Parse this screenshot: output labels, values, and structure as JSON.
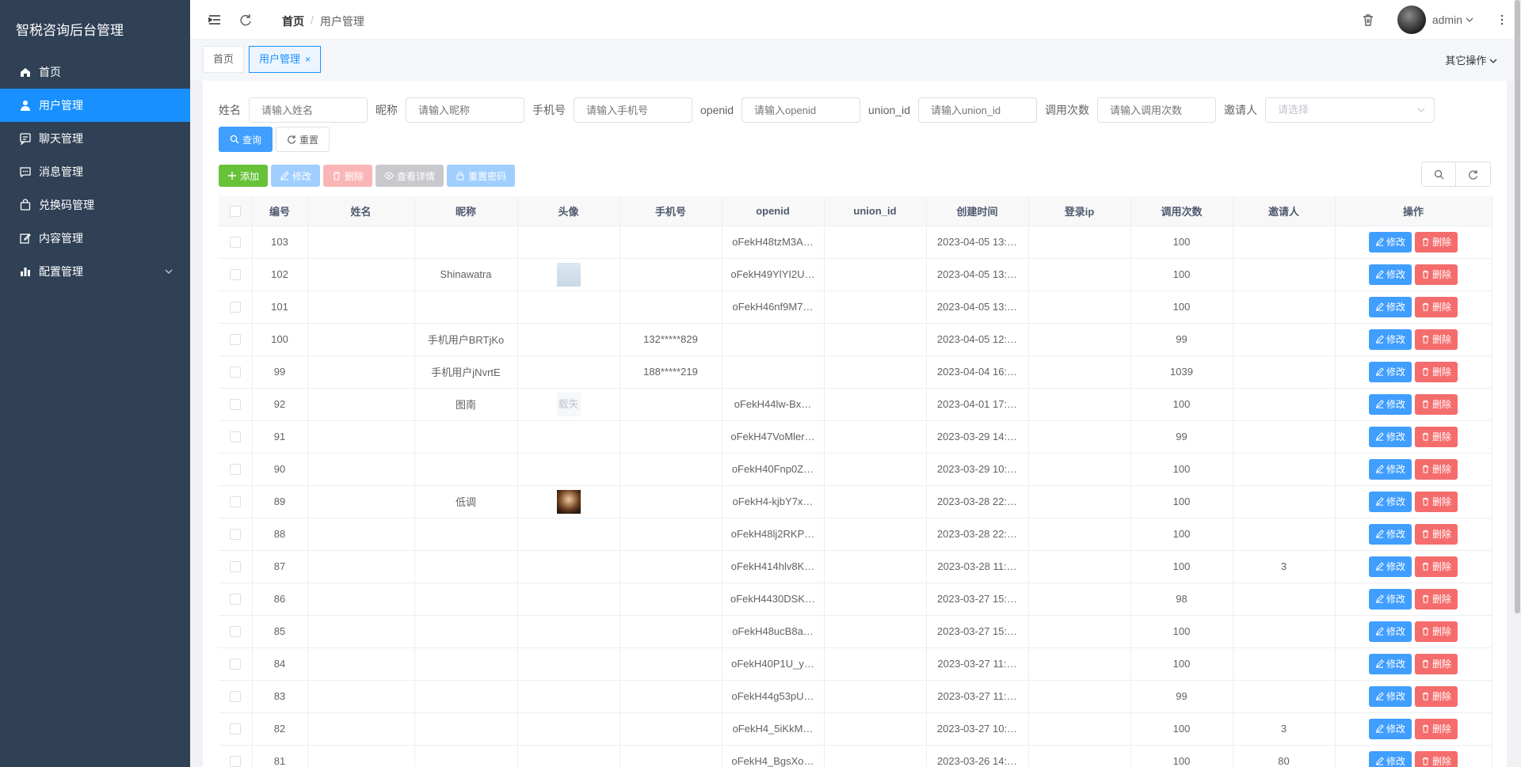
{
  "app": {
    "title": "智税咨询后台管理"
  },
  "sidebar": {
    "items": [
      {
        "label": "首页",
        "icon": "home-icon"
      },
      {
        "label": "用户管理",
        "icon": "user-icon",
        "active": true
      },
      {
        "label": "聊天管理",
        "icon": "chat-icon"
      },
      {
        "label": "消息管理",
        "icon": "message-icon"
      },
      {
        "label": "兑换码管理",
        "icon": "bag-icon"
      },
      {
        "label": "内容管理",
        "icon": "edit-icon"
      },
      {
        "label": "配置管理",
        "icon": "chart-icon",
        "has_children": true
      }
    ]
  },
  "header": {
    "breadcrumb": {
      "home": "首页",
      "separator": "/",
      "current": "用户管理"
    },
    "user_name": "admin"
  },
  "tags": {
    "items": [
      {
        "label": "首页"
      },
      {
        "label": "用户管理",
        "active": true,
        "closable": true
      }
    ],
    "other_ops": "其它操作"
  },
  "search": {
    "fields": [
      {
        "label": "姓名",
        "placeholder": "请输入姓名"
      },
      {
        "label": "昵称",
        "placeholder": "请输入昵称"
      },
      {
        "label": "手机号",
        "placeholder": "请输入手机号"
      },
      {
        "label": "openid",
        "placeholder": "请输入openid"
      },
      {
        "label": "union_id",
        "placeholder": "请输入union_id"
      },
      {
        "label": "调用次数",
        "placeholder": "请输入调用次数"
      },
      {
        "label": "邀请人",
        "placeholder": "请选择"
      }
    ],
    "query_label": "查询",
    "reset_label": "重置"
  },
  "toolbar": {
    "add": "添加",
    "edit": "修改",
    "delete": "删除",
    "detail": "查看详情",
    "reset_password": "重置密码"
  },
  "table": {
    "columns": [
      "编号",
      "姓名",
      "昵称",
      "头像",
      "手机号",
      "openid",
      "union_id",
      "创建时间",
      "登录ip",
      "调用次数",
      "邀请人",
      "操作"
    ],
    "edit_label": "修改",
    "delete_label": "删除",
    "rows": [
      {
        "id": "103",
        "name": "",
        "nickname": "",
        "avatar": "",
        "phone": "",
        "openid": "oFekH48tzM3A…",
        "union_id": "",
        "created": "2023-04-05 13:…",
        "ip": "",
        "calls": "100",
        "inviter": ""
      },
      {
        "id": "102",
        "name": "",
        "nickname": "Shinawatra",
        "avatar": "placeholder",
        "phone": "",
        "openid": "oFekH49YlYI2U…",
        "union_id": "",
        "created": "2023-04-05 13:…",
        "ip": "",
        "calls": "100",
        "inviter": ""
      },
      {
        "id": "101",
        "name": "",
        "nickname": "",
        "avatar": "",
        "phone": "",
        "openid": "oFekH46nf9M7…",
        "union_id": "",
        "created": "2023-04-05 13:…",
        "ip": "",
        "calls": "100",
        "inviter": ""
      },
      {
        "id": "100",
        "name": "",
        "nickname": "手机用户BRTjKo",
        "avatar": "",
        "phone": "132*****829",
        "openid": "",
        "union_id": "",
        "created": "2023-04-05 12:…",
        "ip": "",
        "calls": "99",
        "inviter": ""
      },
      {
        "id": "99",
        "name": "",
        "nickname": "手机用户jNvrtE",
        "avatar": "",
        "phone": "188*****219",
        "openid": "",
        "union_id": "",
        "created": "2023-04-04 16:…",
        "ip": "",
        "calls": "1039",
        "inviter": ""
      },
      {
        "id": "92",
        "name": "",
        "nickname": "图南",
        "avatar": "broken",
        "avatar_text": "载失",
        "phone": "",
        "openid": "oFekH44lw-Bx…",
        "union_id": "",
        "created": "2023-04-01 17:…",
        "ip": "",
        "calls": "100",
        "inviter": ""
      },
      {
        "id": "91",
        "name": "",
        "nickname": "",
        "avatar": "",
        "phone": "",
        "openid": "oFekH47VoMler…",
        "union_id": "",
        "created": "2023-03-29 14:…",
        "ip": "",
        "calls": "99",
        "inviter": ""
      },
      {
        "id": "90",
        "name": "",
        "nickname": "",
        "avatar": "",
        "phone": "",
        "openid": "oFekH40Fnp0Z…",
        "union_id": "",
        "created": "2023-03-29 10:…",
        "ip": "",
        "calls": "100",
        "inviter": ""
      },
      {
        "id": "89",
        "name": "",
        "nickname": "低调",
        "avatar": "photo",
        "phone": "",
        "openid": "oFekH4-kjbY7x…",
        "union_id": "",
        "created": "2023-03-28 22:…",
        "ip": "",
        "calls": "100",
        "inviter": ""
      },
      {
        "id": "88",
        "name": "",
        "nickname": "",
        "avatar": "",
        "phone": "",
        "openid": "oFekH48lj2RKP…",
        "union_id": "",
        "created": "2023-03-28 22:…",
        "ip": "",
        "calls": "100",
        "inviter": ""
      },
      {
        "id": "87",
        "name": "",
        "nickname": "",
        "avatar": "",
        "phone": "",
        "openid": "oFekH414hlv8K…",
        "union_id": "",
        "created": "2023-03-28 11:…",
        "ip": "",
        "calls": "100",
        "inviter": "3"
      },
      {
        "id": "86",
        "name": "",
        "nickname": "",
        "avatar": "",
        "phone": "",
        "openid": "oFekH4430DSK…",
        "union_id": "",
        "created": "2023-03-27 15:…",
        "ip": "",
        "calls": "98",
        "inviter": ""
      },
      {
        "id": "85",
        "name": "",
        "nickname": "",
        "avatar": "",
        "phone": "",
        "openid": "oFekH48ucB8a…",
        "union_id": "",
        "created": "2023-03-27 15:…",
        "ip": "",
        "calls": "100",
        "inviter": ""
      },
      {
        "id": "84",
        "name": "",
        "nickname": "",
        "avatar": "",
        "phone": "",
        "openid": "oFekH40P1U_y…",
        "union_id": "",
        "created": "2023-03-27 11:…",
        "ip": "",
        "calls": "100",
        "inviter": ""
      },
      {
        "id": "83",
        "name": "",
        "nickname": "",
        "avatar": "",
        "phone": "",
        "openid": "oFekH44g53pU…",
        "union_id": "",
        "created": "2023-03-27 11:…",
        "ip": "",
        "calls": "99",
        "inviter": ""
      },
      {
        "id": "82",
        "name": "",
        "nickname": "",
        "avatar": "",
        "phone": "",
        "openid": "oFekH4_5iKkM…",
        "union_id": "",
        "created": "2023-03-27 10:…",
        "ip": "",
        "calls": "100",
        "inviter": "3"
      },
      {
        "id": "81",
        "name": "",
        "nickname": "",
        "avatar": "",
        "phone": "",
        "openid": "oFekH4_BgsXo…",
        "union_id": "",
        "created": "2023-03-26 14:…",
        "ip": "",
        "calls": "100",
        "inviter": "80"
      }
    ]
  },
  "colors": {
    "sidebar_bg": "#304156",
    "active": "#1890ff",
    "primary": "#409eff",
    "danger": "#f56c6c",
    "success": "#67c23a"
  }
}
